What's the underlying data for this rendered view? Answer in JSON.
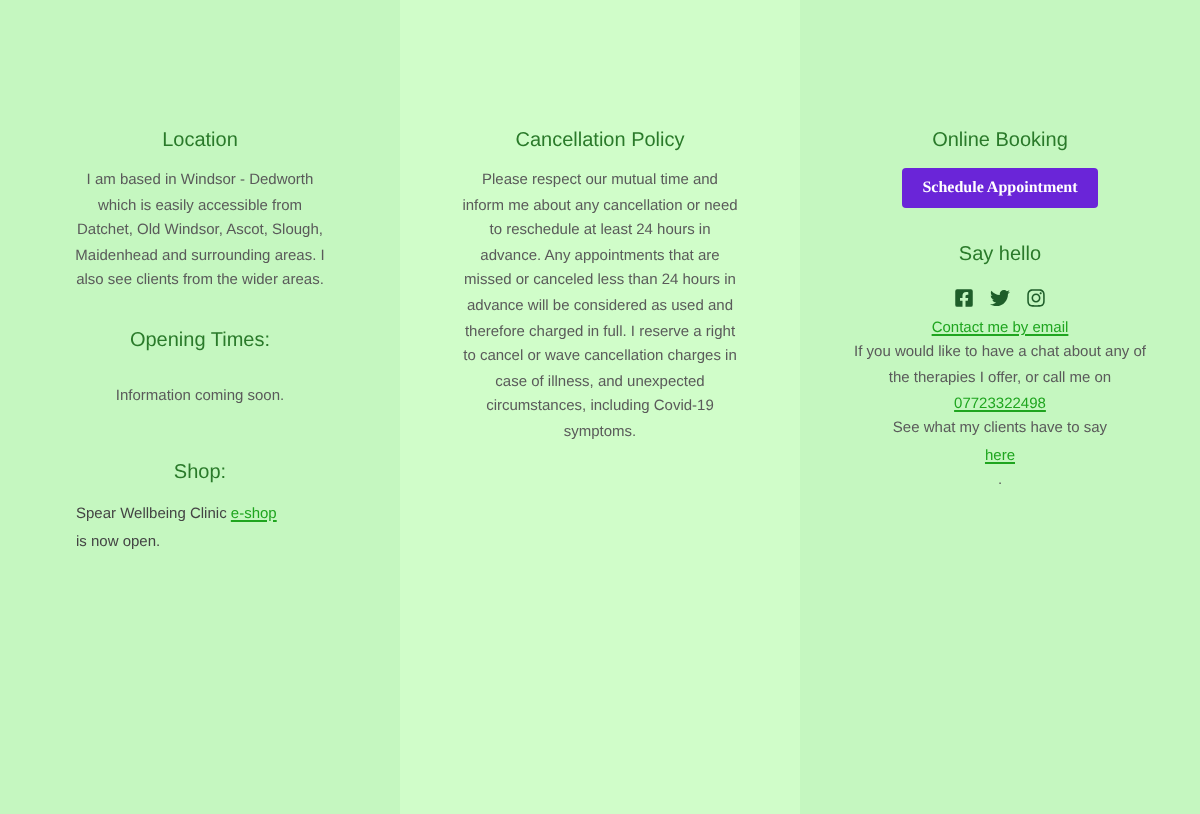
{
  "columns": [
    {
      "blocks": [
        {
          "kind": "heading",
          "text": "Location"
        },
        {
          "kind": "paragraph",
          "text": "I am based in Windsor - Dedworth which is easily accessible from Datchet, Old Windsor, Ascot, Slough, Maidenhead and surrounding areas. I also see clients from the wider areas."
        },
        {
          "kind": "heading",
          "text": "Opening Times:"
        },
        {
          "kind": "paragraph",
          "text": "Information coming soon."
        },
        {
          "kind": "heading",
          "text": "Shop:"
        },
        {
          "kind": "linked",
          "before": "Spear Wellbeing Clinic",
          "link": "e-shop",
          "after": "is now open."
        }
      ]
    },
    {
      "blocks": [
        {
          "kind": "heading",
          "text": "Cancellation Policy"
        },
        {
          "kind": "paragraph",
          "text": "Please respect our mutual time and inform me about any cancellation or need to reschedule at least 24 hours in advance. Any appointments that are missed or canceled less than 24 hours in advance will be considered as used and therefore charged in full. I reserve a right to cancel or wave cancellation charges in case of illness, and unexpected circumstances, including Covid-19 symptoms."
        }
      ]
    },
    {
      "blocks": [
        {
          "kind": "heading",
          "text": "Online Booking"
        },
        {
          "kind": "button",
          "text": "Schedule Appointment"
        },
        {
          "kind": "heading",
          "text": "Say hello"
        },
        {
          "kind": "social"
        },
        {
          "kind": "link",
          "text": "Contact me by email"
        },
        {
          "kind": "paragraph",
          "text": "If you would like to have a chat about any of the therapies I offer, or call me on"
        },
        {
          "kind": "link",
          "text": "07723322498"
        },
        {
          "kind": "paragraph",
          "text": "See what my clients have to say"
        },
        {
          "kind": "link",
          "text": "here"
        },
        {
          "kind": "paragraph",
          "text": "."
        }
      ]
    }
  ]
}
